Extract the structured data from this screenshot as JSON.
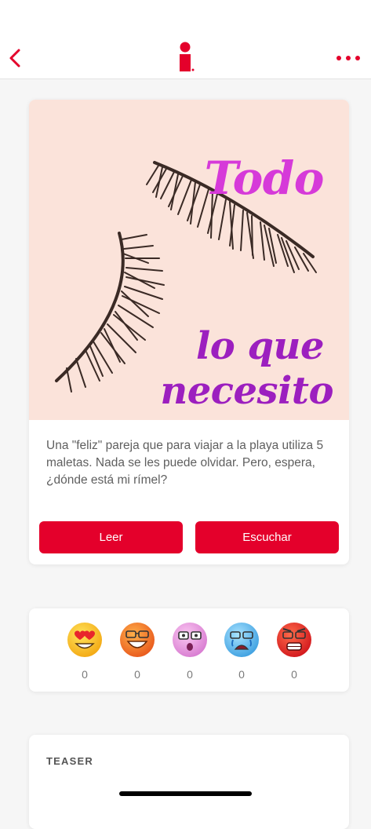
{
  "header": {
    "back_icon": "chevron-left-icon",
    "logo_icon": "app-logo-icon",
    "more_icon": "more-dots-icon",
    "accent_color": "#e4002b"
  },
  "story": {
    "image_text": [
      "Todo",
      "lo que",
      "necesito"
    ],
    "summary": "Una \"feliz\" pareja que para viajar a la playa utiliza 5 maletas. Nada se les puede olvidar. Pero, espera, ¿dónde está mi rímel?",
    "read_label": "Leer",
    "listen_label": "Escuchar"
  },
  "reactions": [
    {
      "icon": "heart-eyes-emoji-icon",
      "count": "0"
    },
    {
      "icon": "laughing-emoji-icon",
      "count": "0"
    },
    {
      "icon": "surprised-emoji-icon",
      "count": "0"
    },
    {
      "icon": "crying-emoji-icon",
      "count": "0"
    },
    {
      "icon": "angry-emoji-icon",
      "count": "0"
    }
  ],
  "teaser": {
    "label": "TEASER"
  }
}
